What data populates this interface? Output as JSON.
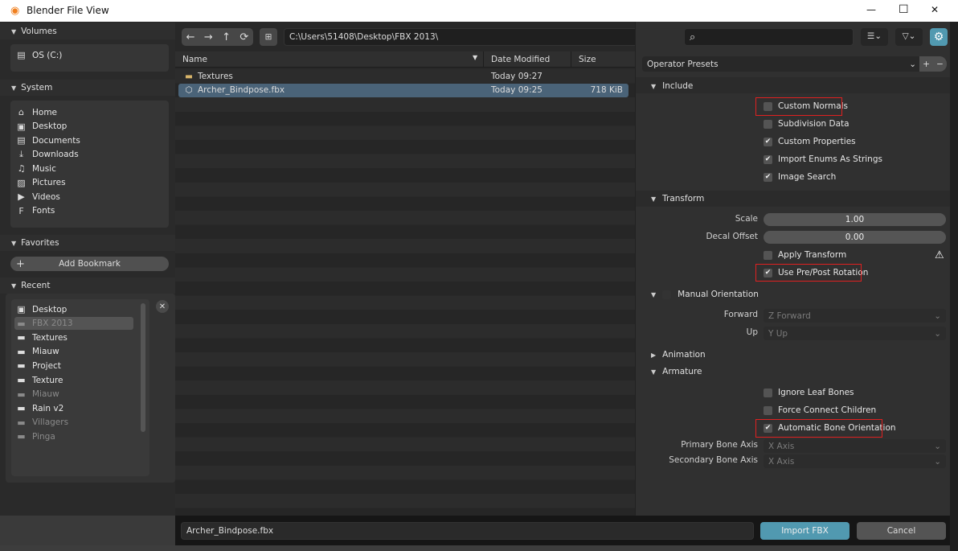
{
  "window": {
    "title": "Blender File View",
    "minimize": "—",
    "maximize": "☐",
    "close": "✕"
  },
  "sidebar": {
    "volumes": {
      "label": "Volumes",
      "items": [
        {
          "label": "OS (C:)",
          "icon": "drive-icon"
        }
      ]
    },
    "system": {
      "label": "System",
      "items": [
        {
          "label": "Home",
          "icon": "home-icon"
        },
        {
          "label": "Desktop",
          "icon": "desktop-icon"
        },
        {
          "label": "Documents",
          "icon": "documents-icon"
        },
        {
          "label": "Downloads",
          "icon": "download-icon"
        },
        {
          "label": "Music",
          "icon": "music-icon"
        },
        {
          "label": "Pictures",
          "icon": "pictures-icon"
        },
        {
          "label": "Videos",
          "icon": "videos-icon"
        },
        {
          "label": "Fonts",
          "icon": "font-icon"
        }
      ]
    },
    "favorites": {
      "label": "Favorites",
      "add_bookmark": "Add Bookmark"
    },
    "recent": {
      "label": "Recent",
      "items": [
        {
          "label": "Desktop",
          "dim": false
        },
        {
          "label": "FBX 2013",
          "dim": true,
          "selected": true
        },
        {
          "label": "Textures",
          "dim": false
        },
        {
          "label": "Miauw",
          "dim": false
        },
        {
          "label": "Project",
          "dim": false
        },
        {
          "label": "Texture",
          "dim": false
        },
        {
          "label": "Miauw",
          "dim": true
        },
        {
          "label": "Rain v2",
          "dim": false
        },
        {
          "label": "Villagers",
          "dim": true
        },
        {
          "label": "Pinga",
          "dim": true
        }
      ]
    }
  },
  "toolbar": {
    "path": "C:\\Users\\51408\\Desktop\\FBX 2013\\",
    "search_placeholder": ""
  },
  "files": {
    "columns": {
      "name": "Name",
      "date": "Date Modified",
      "size": "Size"
    },
    "rows": [
      {
        "name": "Textures",
        "date": "Today 09:27",
        "size": "",
        "type": "folder"
      },
      {
        "name": "Archer_Bindpose.fbx",
        "date": "Today 09:25",
        "size": "718 KiB",
        "type": "mesh",
        "selected": true
      }
    ]
  },
  "props": {
    "presets": "Operator Presets",
    "include": {
      "label": "Include",
      "items": [
        {
          "label": "Custom Normals",
          "checked": false
        },
        {
          "label": "Subdivision Data",
          "checked": false
        },
        {
          "label": "Custom Properties",
          "checked": true
        },
        {
          "label": "Import Enums As Strings",
          "checked": true
        },
        {
          "label": "Image Search",
          "checked": true
        }
      ]
    },
    "transform": {
      "label": "Transform",
      "scale_label": "Scale",
      "scale": "1.00",
      "decal_label": "Decal Offset",
      "decal": "0.00",
      "apply_transform": "Apply Transform",
      "apply_checked": false,
      "prepost": "Use Pre/Post Rotation",
      "prepost_checked": true
    },
    "manual": {
      "label": "Manual Orientation",
      "forward_label": "Forward",
      "forward": "Z Forward",
      "up_label": "Up",
      "up": "Y Up"
    },
    "animation": {
      "label": "Animation"
    },
    "armature": {
      "label": "Armature",
      "items": [
        {
          "label": "Ignore Leaf Bones",
          "checked": false
        },
        {
          "label": "Force Connect Children",
          "checked": false
        },
        {
          "label": "Automatic Bone Orientation",
          "checked": true
        }
      ],
      "primary_label": "Primary Bone Axis",
      "primary": "X Axis",
      "secondary_label": "Secondary Bone Axis",
      "secondary": "X Axis"
    }
  },
  "bottom": {
    "filename": "Archer_Bindpose.fbx",
    "import": "Import FBX",
    "cancel": "Cancel"
  },
  "colors": {
    "accent": "#5199b0",
    "highlight": "#e02020",
    "selection": "#4a6378"
  }
}
